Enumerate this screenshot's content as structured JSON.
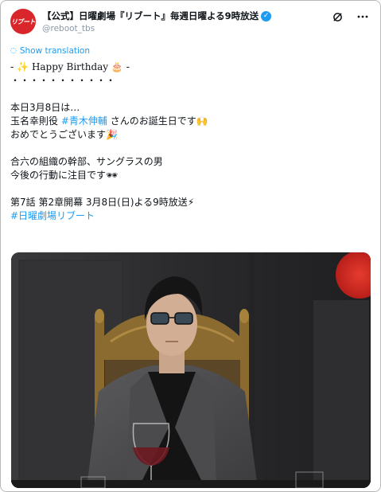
{
  "tweet": {
    "avatar_text": "リブート",
    "display_name": "【公式】日曜劇場『リブート』毎週日曜よる9時放送",
    "verified_glyph": "✓",
    "handle": "@reboot_tbs",
    "grok_icon": "grok-icon",
    "more_icon": "more-icon",
    "translate_label": "Show translation",
    "lines": {
      "l1_prefix": "- ",
      "l1_text": "Happy Birthday",
      "l1_suffix": " -",
      "l2": "・・・・・・・・・・・",
      "l3": "本日3月8日は…",
      "l4_a": "玉名幸則役 ",
      "l4_tag": "#青木伸輔",
      "l4_b": " さんのお誕生日です",
      "l5": "おめでとうございます",
      "l6": "合六の組織の幹部、サングラスの男",
      "l7": "今後の行動に注目です",
      "l8": "第7話 第2章開幕 3月8日(日)よる9時放送",
      "l9_tag": "#日曜劇場リブート"
    },
    "emoji": {
      "sparkle": "✨",
      "cake": "🎂",
      "raise_hands": "🙌",
      "party": "🎉",
      "sunglasses": "🕶",
      "bolt": "⚡"
    }
  },
  "colors": {
    "accent": "#1d9bf0",
    "brand_red": "#d9262b",
    "text": "#0f1419",
    "muted": "#8b98a5"
  }
}
